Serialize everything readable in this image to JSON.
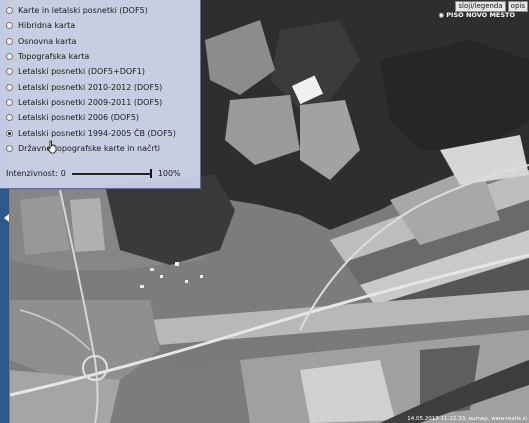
{
  "layers": {
    "options": [
      {
        "label": "Karte in letalski posnetki (DOF5)",
        "selected": false
      },
      {
        "label": "Hibridna karta",
        "selected": false
      },
      {
        "label": "Osnovna karta",
        "selected": false
      },
      {
        "label": "Topografska karta",
        "selected": false
      },
      {
        "label": "Letalski posnetki (DOF5+DOF1)",
        "selected": false
      },
      {
        "label": "Letalski posnetki 2010-2012 (DOF5)",
        "selected": false
      },
      {
        "label": "Letalski posnetki 2009-2011 (DOF5)",
        "selected": false
      },
      {
        "label": "Letalski posnetki 2006 (DOF5)",
        "selected": false
      },
      {
        "label": "Letalski posnetki 1994-2005 ČB (DOF5)",
        "selected": true
      },
      {
        "label": "Državne topografske karte in načrti",
        "selected": false
      }
    ],
    "intensity_label": "Intenzivnost:",
    "intensity_min": "0",
    "intensity_max": "100%",
    "intensity_value": 1.0
  },
  "toolbar": {
    "legend_label": "sloji/legenda",
    "description_label": "opis"
  },
  "map": {
    "place_label": "◉ PISO NOVO MESTO",
    "footer_text": "14.05.2013 11:22:33, eumap, www.realis.si"
  }
}
